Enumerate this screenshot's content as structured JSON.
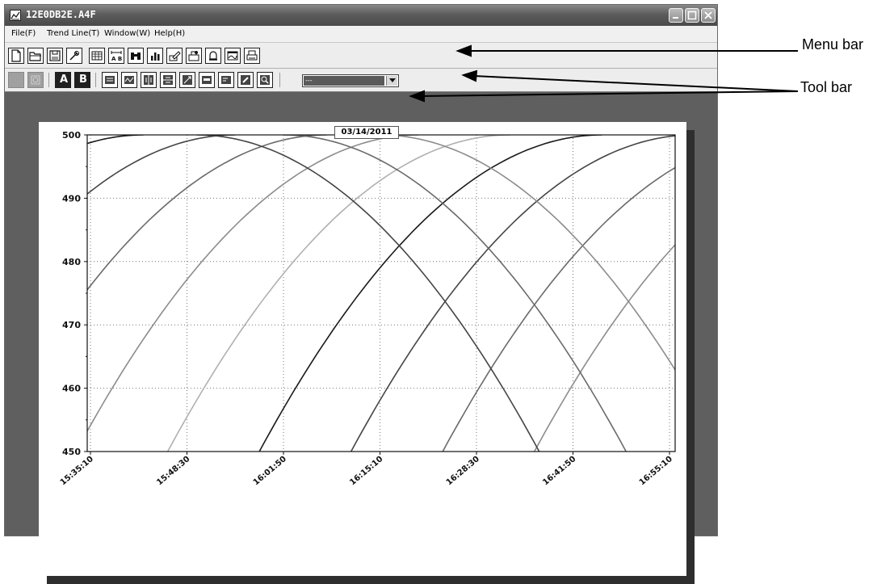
{
  "window": {
    "title": "12E0DB2E.A4F",
    "icon": "trend-app-icon",
    "controls": [
      "minimize-icon",
      "maximize-icon",
      "close-icon"
    ]
  },
  "menu": {
    "items": [
      "File(F)",
      "Trend Line(T)",
      "Window(W)",
      "Help(H)"
    ]
  },
  "toolbar1": {
    "icons": [
      "new-file-icon",
      "open-folder-icon",
      "save-icon",
      "settings-icon",
      "table-icon",
      "ab-scale-icon",
      "binoculars-icon",
      "bar-chart-icon",
      "edit-icon",
      "print-settings-icon",
      "alarm-icon",
      "trend-window-icon",
      "print-icon"
    ]
  },
  "toolbar2": {
    "icons": [
      "record-icon",
      "refresh-icon",
      "cursor-a-icon",
      "cursor-b-icon",
      "data-icon",
      "waveform-icon",
      "split-vertical-icon",
      "split-horizontal-icon",
      "scale-icon",
      "comment-icon",
      "note-icon",
      "pen-icon",
      "zoom-icon"
    ],
    "cursor_a_label": "A",
    "cursor_b_label": "B",
    "combo_value": "---"
  },
  "annotations": {
    "menu_bar": "Menu bar",
    "tool_bar": "Tool bar"
  },
  "chart_data": {
    "type": "line",
    "title": "03/14/2011",
    "ylim": [
      450,
      500
    ],
    "y_ticks": [
      "500",
      "490",
      "480",
      "470",
      "460",
      "450"
    ],
    "x_ticks": [
      "15:35:10",
      "15:48:30",
      "16:01:50",
      "16:15:10",
      "16:28:30",
      "16:41:50",
      "16:55:10"
    ],
    "grid": true,
    "series_colors": [
      "#1a1a1a",
      "#454545",
      "#6a6a6a",
      "#8c8c8c",
      "#b0b0b0"
    ],
    "rising_series_vertex_x": [
      -2.9,
      -2.0,
      -1.55,
      -1.05,
      -0.4,
      0.55,
      1.5,
      2.45,
      3.4,
      4.35,
      5.3,
      6.25,
      7.2,
      8.15
    ],
    "falling_series_vertex_x": [
      1.1,
      2.0,
      3.0
    ],
    "curve_span_ticks": 3.55,
    "curve_drop": 50
  }
}
